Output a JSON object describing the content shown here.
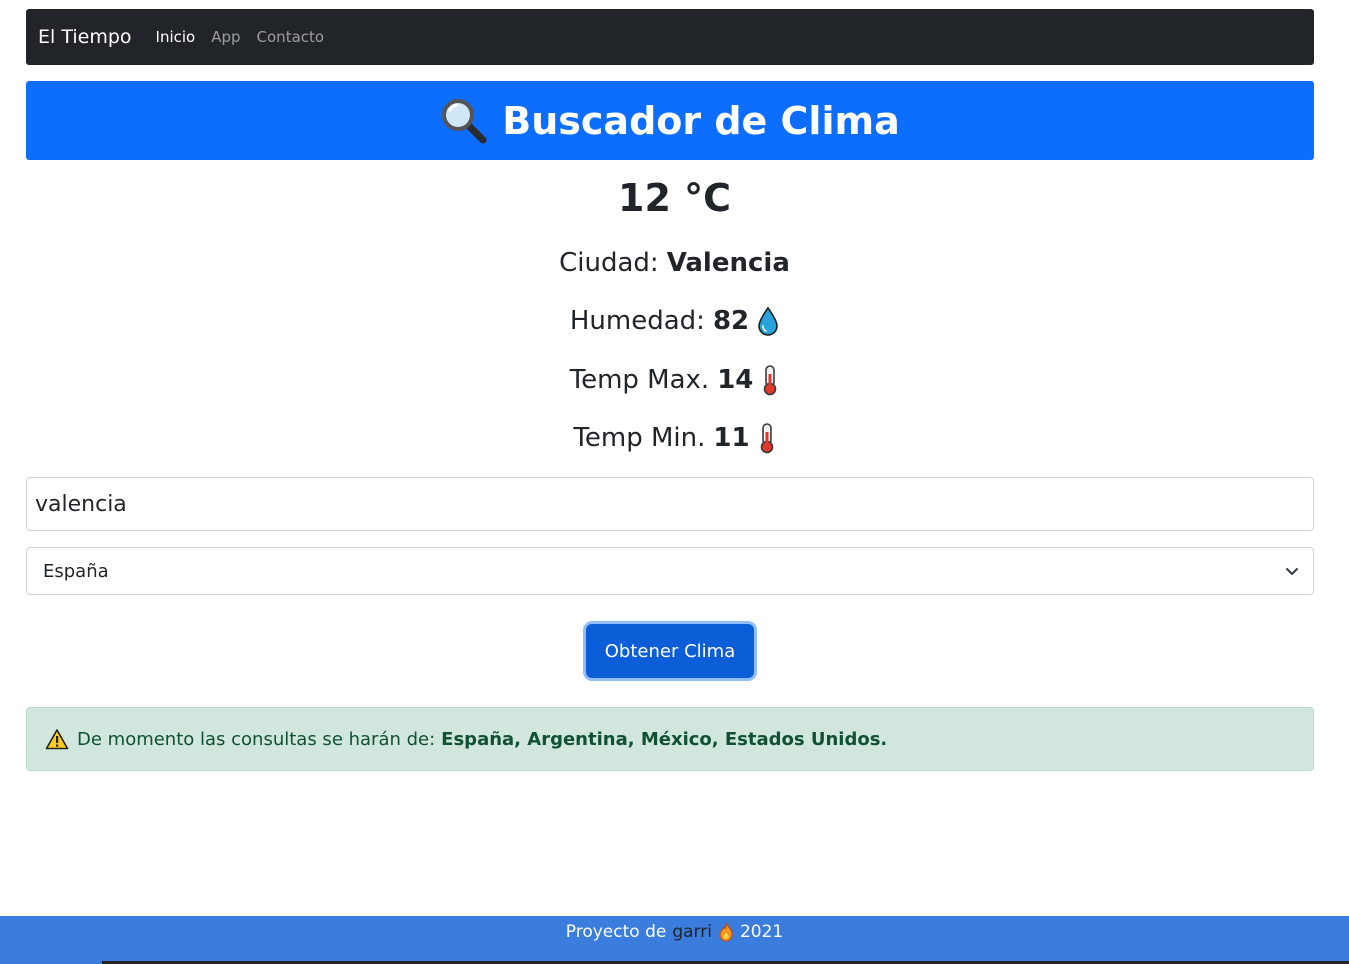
{
  "navbar": {
    "brand": "El Tiempo",
    "links": [
      {
        "label": "Inicio"
      },
      {
        "label": "App"
      },
      {
        "label": "Contacto"
      }
    ]
  },
  "header": {
    "icon": "magnifier-icon",
    "title": "Buscador de Clima"
  },
  "weather": {
    "temperature": "12 °C",
    "city_label": "Ciudad:",
    "city_value": "Valencia",
    "humidity_label": "Humedad:",
    "humidity_value": "82",
    "humidity_icon": "droplet-icon",
    "max_label": "Temp Max.",
    "max_value": "14",
    "min_label": "Temp Min.",
    "min_value": "11",
    "thermometer_icon": "thermometer-icon"
  },
  "form": {
    "city_input_value": "valencia",
    "country_selected": "España",
    "submit_label": "Obtener Clima"
  },
  "alert": {
    "icon": "warning-icon",
    "text": "De momento las consultas se harán de:",
    "countries": "España, Argentina, México, Estados Unidos."
  },
  "footer": {
    "prefix": "Proyecto de",
    "author": "garri",
    "icon": "fire-icon",
    "year": "2021"
  },
  "colors": {
    "navbar_bg": "#212529",
    "banner_bg": "#0d6efd",
    "button_bg": "#0b5ed7",
    "alert_bg": "#d1e7dd",
    "alert_text": "#0f5132",
    "footer_bg": "#3b7ddd"
  }
}
